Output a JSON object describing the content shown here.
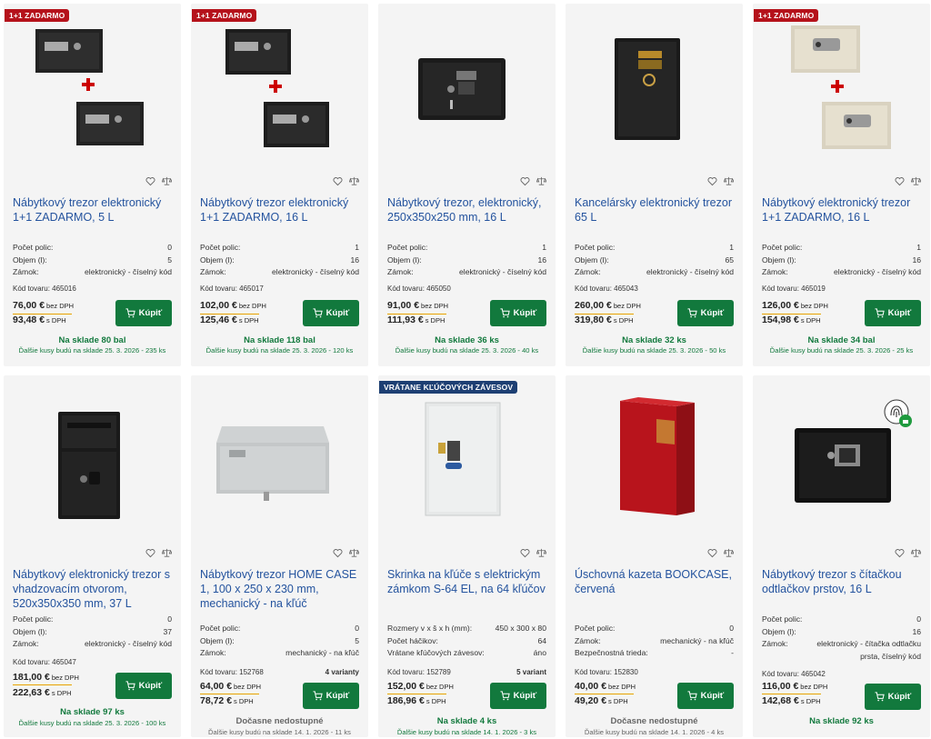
{
  "icons": {
    "wishlist": "heart-icon",
    "compare": "scales-icon",
    "cart": "cart-icon",
    "fingerprint": "fingerprint-lock-icon"
  },
  "colors": {
    "title": "#24539e",
    "buy": "#12793d",
    "stock_green": "#12793d",
    "badge_red": "#b5121b",
    "badge_blue": "#1d3f73",
    "price_line": "#e8a300"
  },
  "products": [
    {
      "badge": "1+1 ZADARMO",
      "title": "Nábytkový trezor elektronický 1+1 ZADARMO, 5 L",
      "specs": [
        {
          "k": "Počet polic:",
          "v": "0"
        },
        {
          "k": "Objem (l):",
          "v": "5"
        },
        {
          "k": "Zámok:",
          "v": "elektronický - číselný kód"
        }
      ],
      "code": "Kód tovaru: 465016",
      "variants": "",
      "price_ex": "76,00 €",
      "price_ex_label": "bez DPH",
      "price_inc": "93,48 €",
      "price_inc_label": "s DPH",
      "buy": "Kúpiť",
      "stock": "Na sklade 80 bal",
      "next": "Ďalšie kusy budú na sklade 25. 3. 2026 - 235 ks"
    },
    {
      "badge": "1+1 ZADARMO",
      "title": "Nábytkový trezor elektronický 1+1 ZADARMO, 16 L",
      "specs": [
        {
          "k": "Počet polic:",
          "v": "1"
        },
        {
          "k": "Objem (l):",
          "v": "16"
        },
        {
          "k": "Zámok:",
          "v": "elektronický - číselný kód"
        }
      ],
      "code": "Kód tovaru: 465017",
      "variants": "",
      "price_ex": "102,00 €",
      "price_ex_label": "bez DPH",
      "price_inc": "125,46 €",
      "price_inc_label": "s DPH",
      "buy": "Kúpiť",
      "stock": "Na sklade 118 bal",
      "next": "Ďalšie kusy budú na sklade 25. 3. 2026 - 120 ks"
    },
    {
      "badge": "",
      "title": "Nábytkový trezor, elektronický, 250x350x250 mm, 16 L",
      "specs": [
        {
          "k": "Počet polic:",
          "v": "1"
        },
        {
          "k": "Objem (l):",
          "v": "16"
        },
        {
          "k": "Zámok:",
          "v": "elektronický - číselný kód"
        }
      ],
      "code": "Kód tovaru: 465050",
      "variants": "",
      "price_ex": "91,00 €",
      "price_ex_label": "bez DPH",
      "price_inc": "111,93 €",
      "price_inc_label": "s DPH",
      "buy": "Kúpiť",
      "stock": "Na sklade 36 ks",
      "next": "Ďalšie kusy budú na sklade 25. 3. 2026 - 40 ks"
    },
    {
      "badge": "",
      "title": "Kancelársky elektronický trezor 65 L",
      "specs": [
        {
          "k": "Počet polic:",
          "v": "1"
        },
        {
          "k": "Objem (l):",
          "v": "65"
        },
        {
          "k": "Zámok:",
          "v": "elektronický - číselný kód"
        }
      ],
      "code": "Kód tovaru: 465043",
      "variants": "",
      "price_ex": "260,00 €",
      "price_ex_label": "bez DPH",
      "price_inc": "319,80 €",
      "price_inc_label": "s DPH",
      "buy": "Kúpiť",
      "stock": "Na sklade 32 ks",
      "next": "Ďalšie kusy budú na sklade 25. 3. 2026 - 50 ks"
    },
    {
      "badge": "1+1 ZADARMO",
      "title": "Nábytkový elektronický trezor 1+1 ZADARMO, 16 L",
      "specs": [
        {
          "k": "Počet polic:",
          "v": "1"
        },
        {
          "k": "Objem (l):",
          "v": "16"
        },
        {
          "k": "Zámok:",
          "v": "elektronický - číselný kód"
        }
      ],
      "code": "Kód tovaru: 465019",
      "variants": "",
      "price_ex": "126,00 €",
      "price_ex_label": "bez DPH",
      "price_inc": "154,98 €",
      "price_inc_label": "s DPH",
      "buy": "Kúpiť",
      "stock": "Na sklade 34 bal",
      "next": "Ďalšie kusy budú na sklade 25. 3. 2026 - 25 ks"
    },
    {
      "badge": "",
      "title": "Nábytkový elektronický trezor s vhadzovacím otvorom, 520x350x350 mm, 37 L",
      "specs": [
        {
          "k": "Počet polic:",
          "v": "0"
        },
        {
          "k": "Objem (l):",
          "v": "37"
        },
        {
          "k": "Zámok:",
          "v": "elektronický - číselný kód"
        }
      ],
      "code": "Kód tovaru: 465047",
      "variants": "",
      "price_ex": "181,00 €",
      "price_ex_label": "bez DPH",
      "price_inc": "222,63 €",
      "price_inc_label": "s DPH",
      "buy": "Kúpiť",
      "stock": "Na sklade 97 ks",
      "next": "Ďalšie kusy budú na sklade 25. 3. 2026 - 100 ks"
    },
    {
      "badge": "",
      "title": "Nábytkový trezor HOME CASE 1, 100 x 250 x 230 mm, mechanický - na kľúč",
      "specs": [
        {
          "k": "Počet polic:",
          "v": "0"
        },
        {
          "k": "Objem (l):",
          "v": "5"
        },
        {
          "k": "Zámok:",
          "v": "mechanický - na kľúč"
        }
      ],
      "code": "Kód tovaru: 152768",
      "variants": "4 varianty",
      "price_ex": "64,00 €",
      "price_ex_label": "bez DPH",
      "price_inc": "78,72 €",
      "price_inc_label": "s DPH",
      "buy": "Kúpiť",
      "stock": "Dočasne nedostupné",
      "next": "Ďalšie kusy budú na sklade 14. 1. 2026 - 11 ks"
    },
    {
      "badge": "VRÁTANE KĽÚČOVÝCH ZÁVESOV",
      "title": "Skrinka na kľúče s elektrickým zámkom S-64 EL, na 64 kľúčov",
      "specs": [
        {
          "k": "Rozmery v x š x h (mm):",
          "v": "450 x 300 x 80"
        },
        {
          "k": "Počet háčikov:",
          "v": "64"
        },
        {
          "k": "Vrátane kľúčových závesov:",
          "v": "áno"
        }
      ],
      "code": "Kód tovaru: 152789",
      "variants": "5 variant",
      "price_ex": "152,00 €",
      "price_ex_label": "bez DPH",
      "price_inc": "186,96 €",
      "price_inc_label": "s DPH",
      "buy": "Kúpiť",
      "stock": "Na sklade 4 ks",
      "next": "Ďalšie kusy budú na sklade 14. 1. 2026 - 3 ks"
    },
    {
      "badge": "",
      "title": "Úschovná kazeta BOOKCASE, červená",
      "specs": [
        {
          "k": "Počet polic:",
          "v": "0"
        },
        {
          "k": "Zámok:",
          "v": "mechanický - na kľúč"
        },
        {
          "k": "Bezpečnostná trieda:",
          "v": "-"
        }
      ],
      "code": "Kód tovaru: 152830",
      "variants": "",
      "price_ex": "40,00 €",
      "price_ex_label": "bez DPH",
      "price_inc": "49,20 €",
      "price_inc_label": "s DPH",
      "buy": "Kúpiť",
      "stock": "Dočasne nedostupné",
      "next": "Ďalšie kusy budú na sklade 14. 1. 2026 - 4 ks"
    },
    {
      "badge": "",
      "title": "Nábytkový trezor s čítačkou odtlačkov prstov, 16 L",
      "specs": [
        {
          "k": "Počet polic:",
          "v": "0"
        },
        {
          "k": "Objem (l):",
          "v": "16"
        },
        {
          "k": "Zámok:",
          "v": "elektronický - čítačka odtlačku prsta, číselný kód"
        }
      ],
      "code": "Kód tovaru: 465042",
      "variants": "",
      "price_ex": "116,00 €",
      "price_ex_label": "bez DPH",
      "price_inc": "142,68 €",
      "price_inc_label": "s DPH",
      "buy": "Kúpiť",
      "stock": "Na sklade 92 ks",
      "next": ""
    }
  ]
}
